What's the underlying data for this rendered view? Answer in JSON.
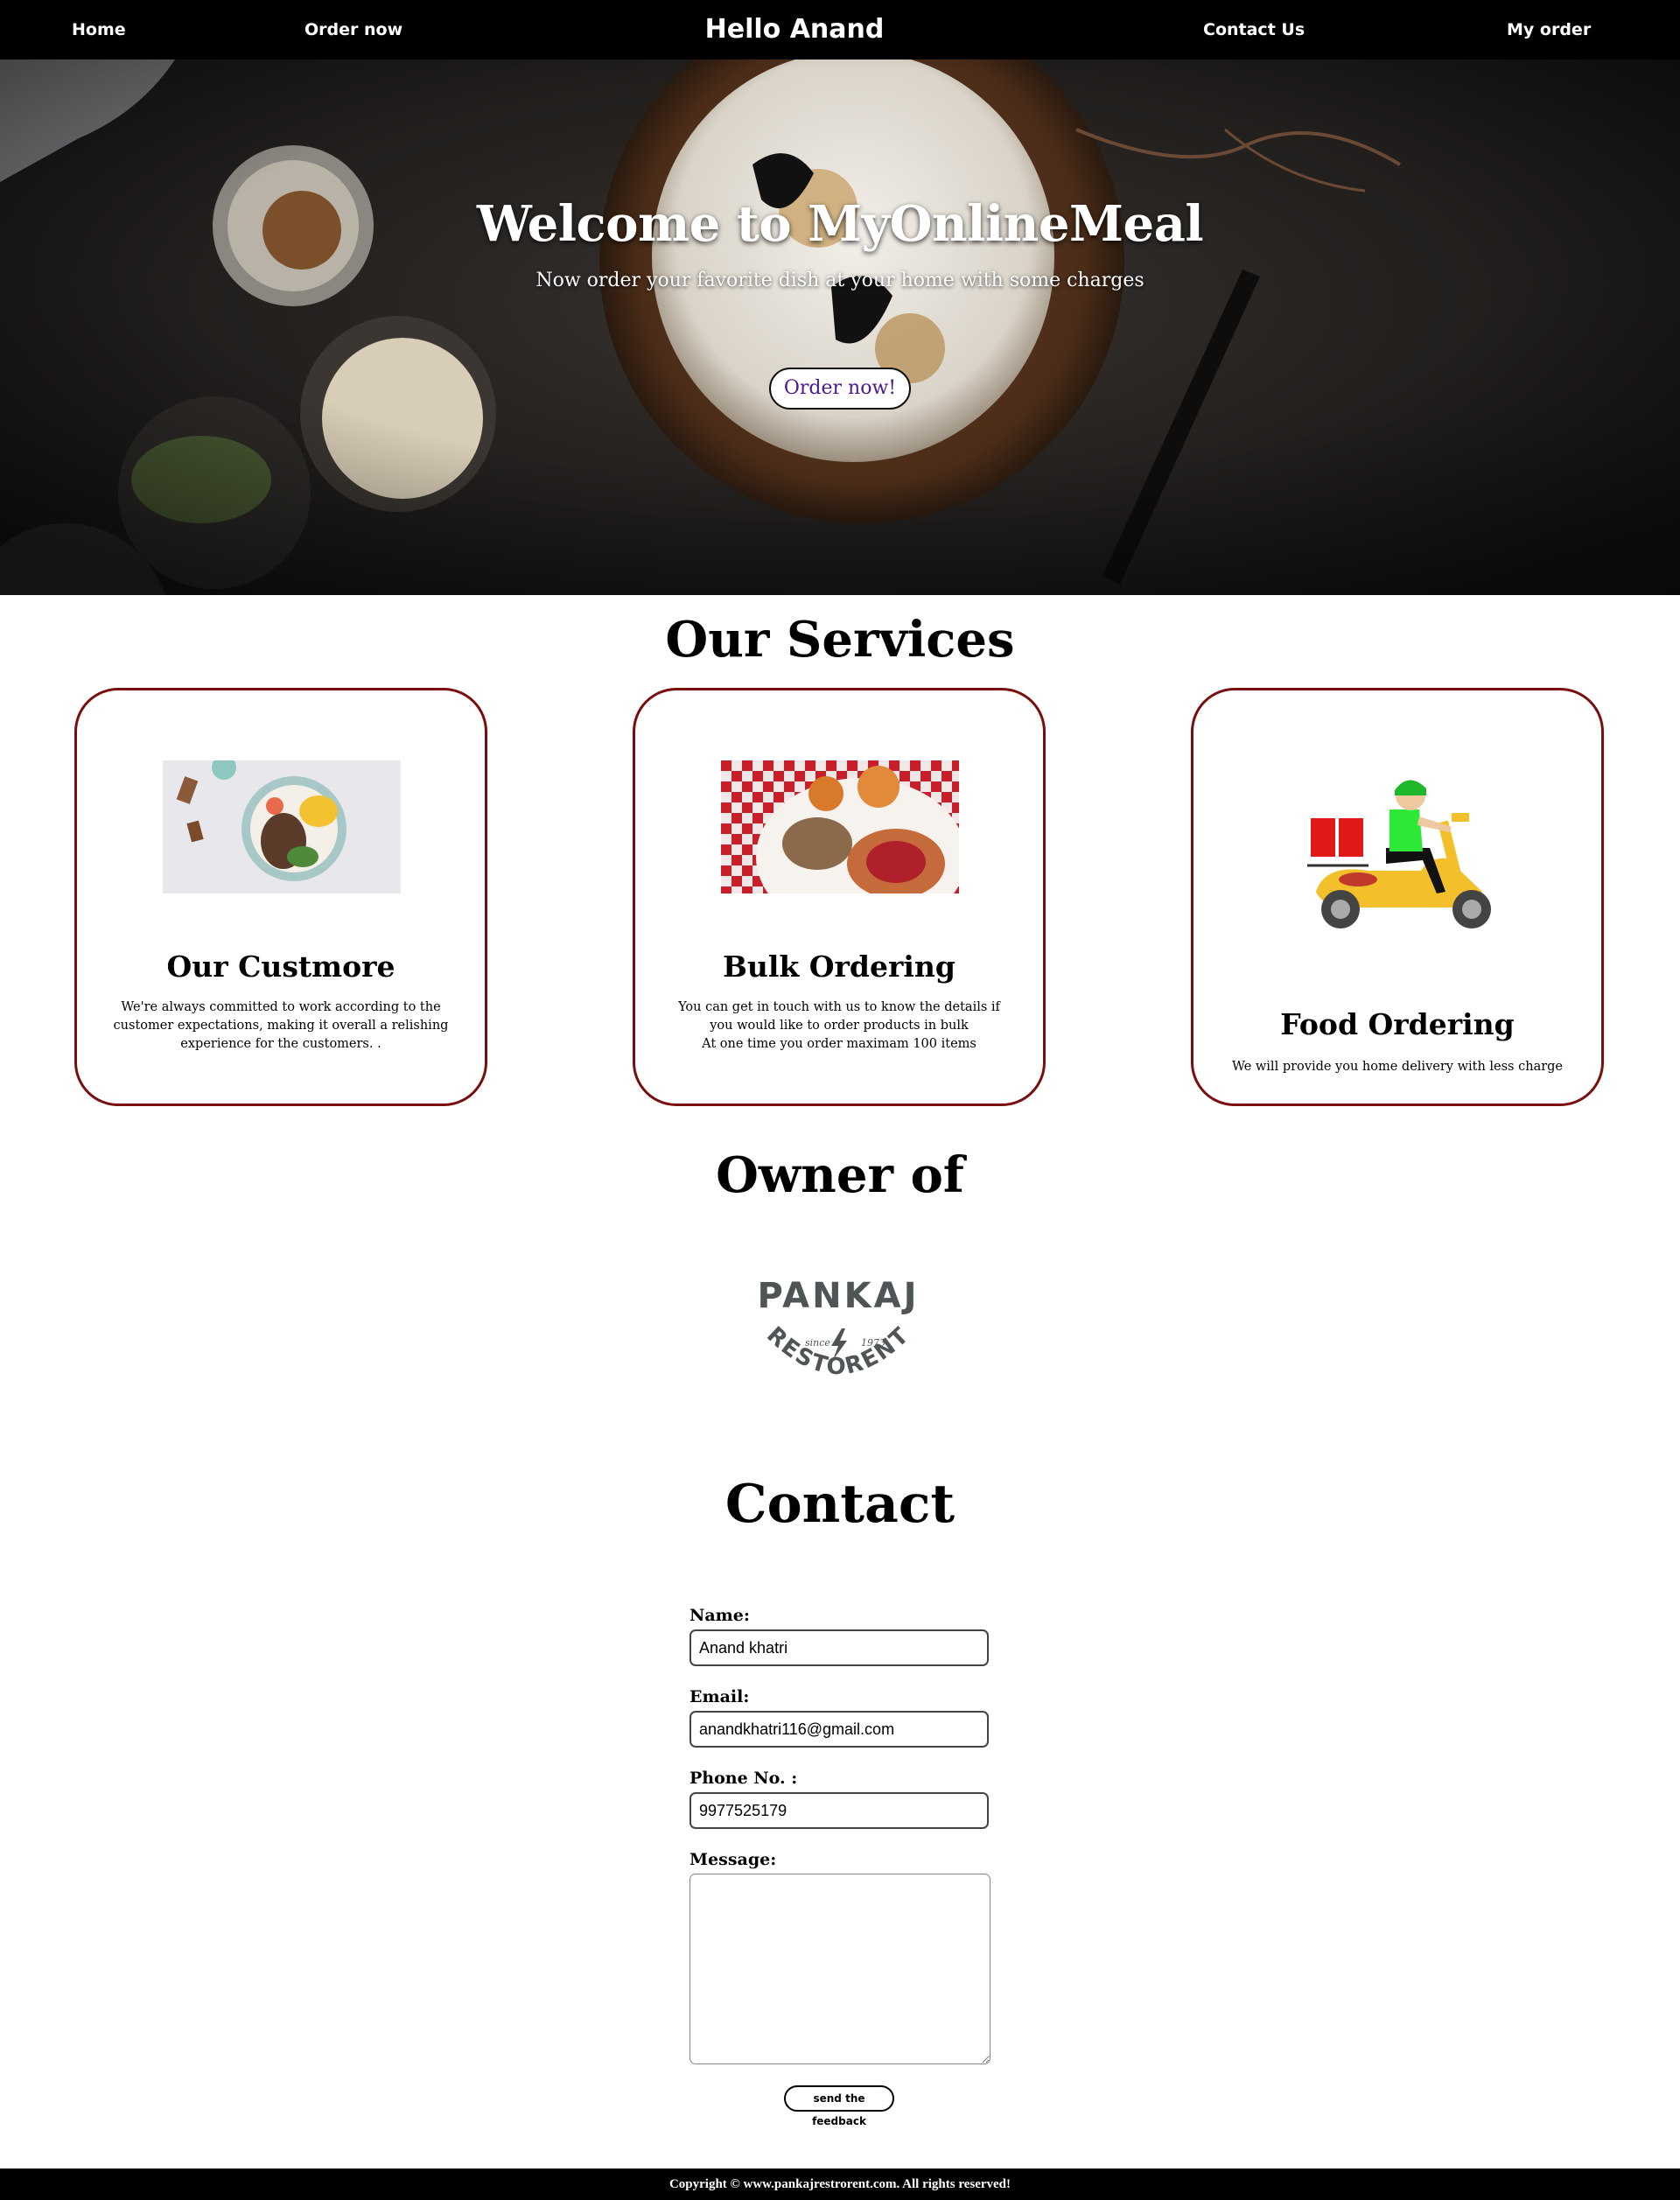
{
  "nav": {
    "home": "Home",
    "order_now": "Order now",
    "greeting": "Hello Anand",
    "contact_us": "Contact Us",
    "my_order": "My order"
  },
  "hero": {
    "title": "Welcome to MyOnlineMeal",
    "subtitle": "Now order your favorite dish at your home with some charges",
    "button": "Order now!"
  },
  "services": {
    "title": "Our Services",
    "cards": [
      {
        "title": "Our Custmore",
        "text": "We're always committed to work according to the customer expectations, making it overall a relishing experience for the customers. .",
        "image": "salad-bowl-photo"
      },
      {
        "title": "Bulk Ordering",
        "text_line1": "You can get in touch with us to know the details if you would like to order products in bulk",
        "text_line2": "At one time you order maximam 100 items",
        "image": "breakfast-plate-photo"
      },
      {
        "title": "Food Ordering",
        "text": "We will provide you home delivery with less charge",
        "image": "delivery-scooter-illustration"
      }
    ]
  },
  "owner": {
    "title": "Owner of",
    "logo": {
      "top": "PANKAJ",
      "bottom": "RESTORENT",
      "since": "since",
      "year": "1973",
      "color": "#4f5457"
    }
  },
  "contact": {
    "title": "Contact",
    "name_label": "Name:",
    "name_value": "Anand khatri",
    "email_label": "Email:",
    "email_value": "anandkhatri116@gmail.com",
    "phone_label": "Phone No. :",
    "phone_value": "9977525179",
    "message_label": "Message:",
    "message_value": "",
    "send_button": "send the feedback"
  },
  "footer": {
    "text": "Copyright © www.pankajrestrorent.com. All rights reserved!"
  },
  "colors": {
    "nav_bg": "#000000",
    "card_border": "#7a0d0d",
    "hero_button_text": "#4b1a8c"
  }
}
